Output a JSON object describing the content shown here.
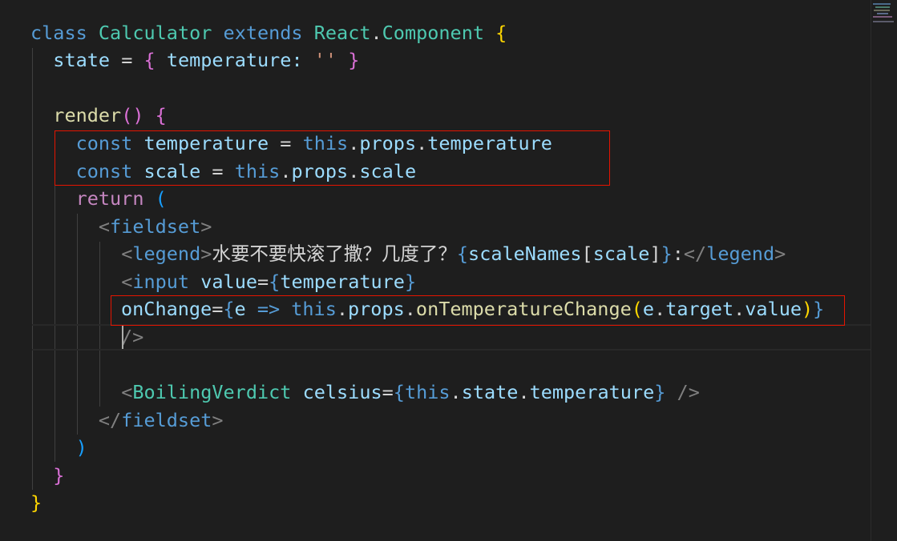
{
  "editor": {
    "language": "javascript-react",
    "lines": {
      "l1": {
        "kw_class": "class",
        "class_name": "Calculator",
        "kw_extends": "extends",
        "base_obj": "React",
        "dot": ".",
        "base_cls": "Component",
        "open": "{"
      },
      "l2": {
        "prop": "state",
        "eq": "=",
        "open": "{",
        "key": "temperature",
        "colon": ":",
        "str": "''",
        "close": "}"
      },
      "l4": {
        "fn": "render",
        "parens": "()",
        "open": "{"
      },
      "l5": {
        "kw": "const",
        "name": "temperature",
        "eq": "=",
        "this": "this",
        "dot1": ".",
        "props": "props",
        "dot2": ".",
        "field": "temperature"
      },
      "l6": {
        "kw": "const",
        "name": "scale",
        "eq": "=",
        "this": "this",
        "dot1": ".",
        "props": "props",
        "dot2": ".",
        "field": "scale"
      },
      "l7": {
        "kw": "return",
        "paren": "("
      },
      "l8": {
        "lt": "<",
        "tag": "fieldset",
        "gt": ">"
      },
      "l9": {
        "lt": "<",
        "tag": "legend",
        "gt": ">",
        "text": "水要不要快滚了撒？几度了？",
        "ob": "{",
        "var": "scaleNames",
        "lb": "[",
        "idx": "scale",
        "rb": "]",
        "cb": "}",
        "colon": ":",
        "close_lt": "</",
        "close_tag": "legend",
        "close_gt": ">"
      },
      "l10": {
        "lt": "<",
        "tag": "input",
        "attr": "value",
        "eq": "=",
        "ob": "{",
        "val": "temperature",
        "cb": "}"
      },
      "l11": {
        "attr": "onChange",
        "eq": "=",
        "ob": "{",
        "param": "e",
        "arrow": "=>",
        "this": "this",
        "d1": ".",
        "props": "props",
        "d2": ".",
        "method": "onTemperatureChange",
        "op": "(",
        "e": "e",
        "d3": ".",
        "target": "target",
        "d4": ".",
        "value": "value",
        "cp": ")",
        "cb": "}"
      },
      "l12": {
        "selfclose": "/>"
      },
      "l14": {
        "lt": "<",
        "tag": "BoilingVerdict",
        "attr": "celsius",
        "eq": "=",
        "ob": "{",
        "this": "this",
        "d1": ".",
        "state": "state",
        "d2": ".",
        "field": "temperature",
        "cb": "}",
        "selfclose": "/>"
      },
      "l15": {
        "close_lt": "</",
        "tag": "fieldset",
        "gt": ">"
      },
      "l16": {
        "paren": ")"
      },
      "l17": {
        "close": "}"
      },
      "l18": {
        "close": "}"
      }
    }
  },
  "colors": {
    "background": "#1e1e1e",
    "keyword": "#569cd6",
    "control_keyword": "#c586c0",
    "class_name": "#4ec9b0",
    "function": "#dcdcaa",
    "variable": "#9cdcfe",
    "string": "#ce9178",
    "highlight_box": "#e51400"
  }
}
